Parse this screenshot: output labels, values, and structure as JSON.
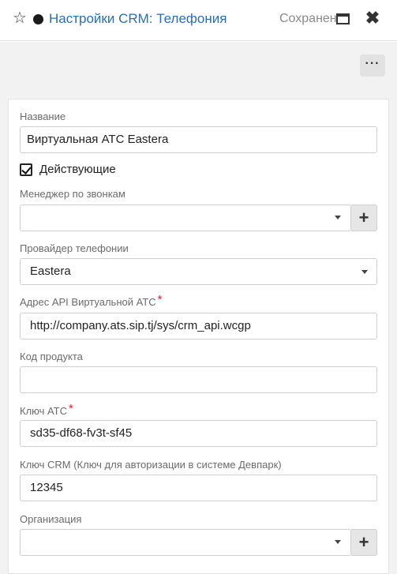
{
  "header": {
    "title": "Настройки CRM: Телефония",
    "saved_label": "Сохранен",
    "close_symbol": "✖",
    "star_symbol": "☆"
  },
  "toolbar": {
    "more_label": "···"
  },
  "form": {
    "name": {
      "label": "Название",
      "value": "Виртуальная АТС Eastera"
    },
    "active": {
      "label": "Действующие",
      "checked": true
    },
    "call_manager": {
      "label": "Менеджер по звонкам",
      "value": ""
    },
    "provider": {
      "label": "Провайдер телефонии",
      "value": "Eastera"
    },
    "api_address": {
      "label": "Адрес API Виртуальной АТС",
      "required": "*",
      "value": "http://company.ats.sip.tj/sys/crm_api.wcgp"
    },
    "product_code": {
      "label": "Код продукта",
      "value": ""
    },
    "ats_key": {
      "label": "Ключ АТС",
      "required": "*",
      "value": "sd35-df68-fv3t-sf45"
    },
    "crm_key": {
      "label": "Ключ CRM (Ключ для авторизации в системе Девпарк)",
      "value": "12345"
    },
    "organization": {
      "label": "Организация",
      "value": ""
    },
    "plus_symbol": "+"
  }
}
